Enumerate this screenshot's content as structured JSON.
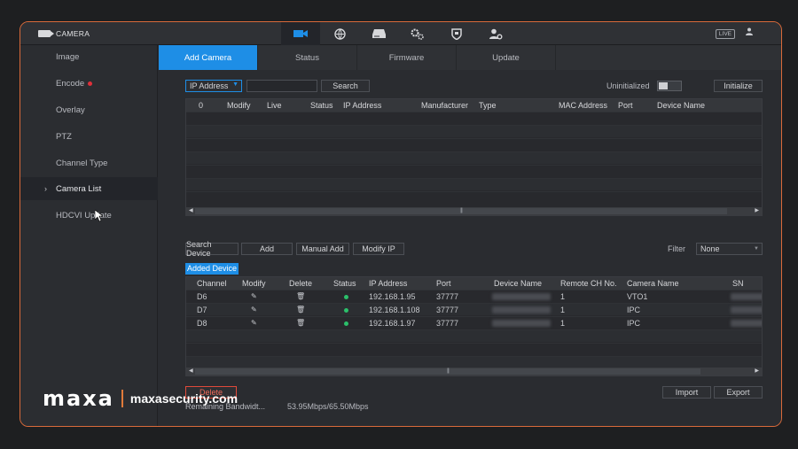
{
  "window": {
    "title": "CAMERA",
    "live_badge": "LIVE",
    "user_icon": "user-icon"
  },
  "top_icons": [
    "camera-icon",
    "network-icon",
    "storage-icon",
    "settings-icon",
    "security-icon",
    "account-icon"
  ],
  "sidebar": {
    "items": [
      {
        "label": "Image"
      },
      {
        "label": "Encode"
      },
      {
        "label": "Overlay"
      },
      {
        "label": "PTZ"
      },
      {
        "label": "Channel Type"
      },
      {
        "label": "Camera List"
      },
      {
        "label": "HDCVI Update"
      }
    ],
    "active": "Camera List"
  },
  "tabs": [
    {
      "label": "Add Camera"
    },
    {
      "label": "Status"
    },
    {
      "label": "Firmware"
    },
    {
      "label": "Update"
    }
  ],
  "search_bar": {
    "filter_type": "IP Address",
    "search_value": "",
    "search_label": "Search",
    "uninitialized_label": "Uninitialized",
    "initialize_label": "Initialize"
  },
  "device_table": {
    "columns": [
      "0",
      "Modify",
      "Live",
      "Status",
      "IP Address",
      "Manufacturer",
      "Type",
      "MAC Address",
      "Port",
      "Device Name"
    ]
  },
  "actions": {
    "search_device": "Search Device",
    "add": "Add",
    "manual_add": "Manual Add",
    "modify_ip": "Modify IP",
    "filter_label": "Filter",
    "filter_value": "None"
  },
  "added_device": {
    "title": "Added Device",
    "columns": [
      "Channel",
      "Modify",
      "Delete",
      "Status",
      "IP Address",
      "Port",
      "Device Name",
      "Remote CH No.",
      "Camera Name",
      "SN"
    ],
    "rows": [
      {
        "channel": "D6",
        "ip": "192.168.1.95",
        "port": "37777",
        "remote_ch": "1",
        "camera_name": "VTO1"
      },
      {
        "channel": "D7",
        "ip": "192.168.1.108",
        "port": "37777",
        "remote_ch": "1",
        "camera_name": "IPC"
      },
      {
        "channel": "D8",
        "ip": "192.168.1.97",
        "port": "37777",
        "remote_ch": "1",
        "camera_name": "IPC"
      }
    ]
  },
  "footer": {
    "delete_label": "Delete",
    "import_label": "Import",
    "export_label": "Export",
    "bandwidth_label": "Remaining Bandwidt...",
    "bandwidth_value": "53.95Mbps/65.50Mbps"
  },
  "watermark": {
    "brand": "maxa",
    "site": "maxasecurity.com"
  },
  "colors": {
    "accent": "#1e8ee6",
    "frame": "#d96a3a",
    "status_ok": "#2bc06a",
    "alert": "#e0303a"
  }
}
